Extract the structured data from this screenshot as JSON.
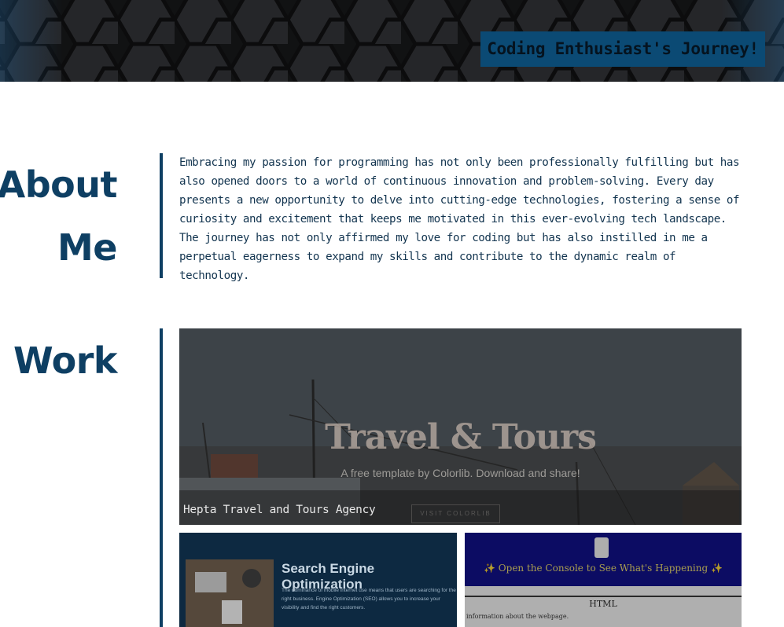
{
  "header": {
    "title": "Coding Enthusiast's Journey!"
  },
  "about": {
    "heading_line1": "About",
    "heading_line2": "Me",
    "text": "Embracing my passion for programming has not only been professionally fulfilling but has also opened doors to a world of continuous innovation and problem-solving. Every day presents a new opportunity to delve into cutting-edge technologies, fostering a sense of curiosity and excitement that keeps me motivated in this ever-evolving tech landscape. The journey has not only affirmed my love for coding but has also instilled in me a perpetual eagerness to expand my skills and contribute to the dynamic realm of technology."
  },
  "work": {
    "heading": "Work",
    "projects": [
      {
        "caption": "Hepta Travel and Tours Agency",
        "preview_title": "Travel & Tours",
        "preview_subtitle": "A free template by Colorlib. Download and share!",
        "preview_button": "VISIT COLORLIB"
      },
      {
        "preview_title": "Search Engine Optimization",
        "preview_text": "The dominance of mobile internet use means that users are searching for the right business. Engine Optimization (SEO) allows you to increase your visibility and find the right customers."
      },
      {
        "preview_banner": "✨ Open the Console to See What's Happening ✨",
        "preview_heading": "HTML",
        "preview_text": "information about the webpage."
      }
    ]
  },
  "colors": {
    "accent": "#0e3f63",
    "header_bg": "#1c1d1f",
    "title_box": "#0b4a74"
  }
}
